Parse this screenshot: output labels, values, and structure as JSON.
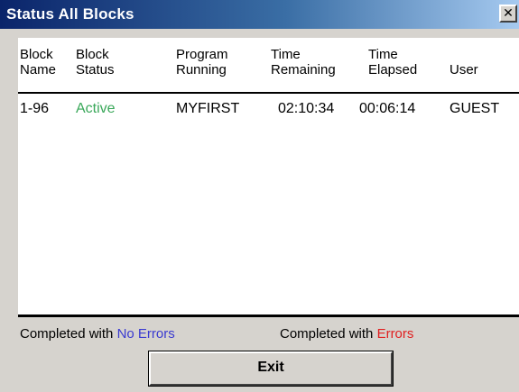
{
  "window": {
    "title": "Status All Blocks",
    "close_glyph": "✕"
  },
  "table": {
    "columns": [
      [
        "Block",
        "Name"
      ],
      [
        "Block",
        "Status"
      ],
      [
        "Program",
        "Running"
      ],
      [
        "Time",
        "Remaining"
      ],
      [
        "Time",
        "Elapsed"
      ],
      [
        "User"
      ]
    ],
    "rows": [
      {
        "block_name": "1-96",
        "block_status": "Active",
        "program_running": "MYFIRST",
        "time_remaining": "02:10:34",
        "time_elapsed": "00:06:14",
        "user": "GUEST"
      }
    ]
  },
  "legend": {
    "completed_with": "Completed with",
    "no_errors": "No Errors",
    "errors": "Errors"
  },
  "buttons": {
    "exit": "Exit"
  },
  "colors": {
    "active_status": "#3aa85a",
    "no_errors": "#3a3ad0",
    "errors": "#e02020"
  }
}
